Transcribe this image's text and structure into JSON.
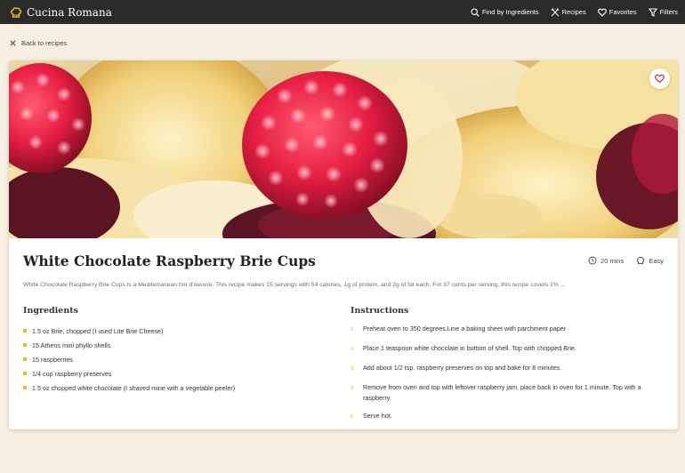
{
  "header": {
    "brand": "Cucina Romana",
    "nav": [
      {
        "label": "Find by Ingredients",
        "icon": "search-icon"
      },
      {
        "label": "Recipes",
        "icon": "utensils-icon"
      },
      {
        "label": "Favorites",
        "icon": "heart-icon"
      },
      {
        "label": "Filters",
        "icon": "filter-icon"
      }
    ]
  },
  "back_label": "Back to recipes",
  "recipe": {
    "title": "White Chocolate Raspberry Brie Cups",
    "time": "20 mins",
    "difficulty": "Easy",
    "summary": "White Chocolate Raspberry Brie Cups is a Mediterranean hor d'oeuvre. This recipe makes 15 servings with 54 calories, 1g of protein, and 2g of fat each. For 37 cents per serving, this recipe covers 1% ...",
    "ingredients_heading": "Ingredients",
    "instructions_heading": "Instructions",
    "ingredients": [
      "1.5 oz Brie, chopped (I used Lite Brie Cheese)",
      "15 Athens mini phyllo shells",
      "15 raspberries",
      "1/4 cup raspberry preserves",
      "1.5 oz chopped white chocolate (I shaved mine with a vegetable peeler)"
    ],
    "instructions": [
      {
        "num": "1.",
        "text": "Preheat oven to 350 degrees.Line a baking sheet with parchment paper"
      },
      {
        "num": "2.",
        "text": "Place 1 teaspoon white chocolate in bottom of shell. Top with chopped Brie."
      },
      {
        "num": "3.",
        "text": "Add about 1/2 tsp. raspberry preserves on top and bake for 8 minutes."
      },
      {
        "num": "4.",
        "text": "Remove from oven and top with leftover raspberry jam, place back in oven for 1 minute. Top with a raspberry."
      },
      {
        "num": "5.",
        "text": "Serve hot."
      }
    ]
  },
  "colors": {
    "accent": "#e8b830",
    "topbar": "#2a2a2a",
    "background": "#f6efe1",
    "favorite": "#c0392b"
  }
}
